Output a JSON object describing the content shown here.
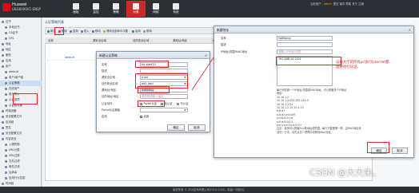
{
  "header": {
    "brand": "Huawei",
    "model": "USG6000V1-ENSP",
    "nav": [
      {
        "label": "面板",
        "icon": "dashboard-icon"
      },
      {
        "label": "监控",
        "icon": "monitor-icon"
      },
      {
        "label": "策略",
        "icon": "policy-icon"
      },
      {
        "label": "对象",
        "icon": "object-icon"
      },
      {
        "label": "网络",
        "icon": "network-icon"
      },
      {
        "label": "系统",
        "icon": "system-icon"
      }
    ],
    "userinfo_prefix": "当前用户：",
    "username": "admin",
    "userinfo_rest": " 提交  保存  帮助  关于  注销"
  },
  "sidebar": {
    "items": [
      {
        "label": "证书"
      },
      {
        "label": "本地证书"
      },
      {
        "label": "CA证书"
      },
      {
        "label": "CRL"
      },
      {
        "label": "地址"
      },
      {
        "label": "地区"
      },
      {
        "label": "服务"
      },
      {
        "label": "应用"
      },
      {
        "label": "用户"
      },
      {
        "label": "default"
      },
      {
        "label": "用户/用户组"
      },
      {
        "label": "认证策略"
      },
      {
        "label": "在线用户"
      },
      {
        "label": "用户导入"
      },
      {
        "label": "认证选项"
      },
      {
        "label": "认证服务器"
      },
      {
        "label": "终端设备"
      },
      {
        "label": "安全配置文件"
      },
      {
        "label": "应用组"
      },
      {
        "label": "签名"
      },
      {
        "label": "安全配置文件"
      },
      {
        "label": "内容安全"
      },
      {
        "label": "入侵防御"
      },
      {
        "label": "URL分类"
      },
      {
        "label": "URL过滤"
      },
      {
        "label": "文件过滤"
      },
      {
        "label": "邮件过滤"
      },
      {
        "label": "反病毒"
      },
      {
        "label": "应用行为控制"
      },
      {
        "label": "时间段"
      }
    ]
  },
  "main": {
    "tab": "认证策略列表",
    "toolbar": [
      "新建",
      "删除",
      "复制",
      "插入",
      "移动",
      "清除全部命中次数",
      "启用",
      "禁用"
    ],
    "search_label": "请输入要查询的内容",
    "columns": [
      "名称",
      "源安全区域",
      "目的安全区域",
      "源地址/地区",
      "目的地址/地区",
      "认证动作",
      "命中次数",
      "启用",
      "编辑"
    ],
    "rows": [
      {
        "name": "default"
      }
    ]
  },
  "dialog1": {
    "title": "新建认证策略",
    "fields": [
      {
        "label": "名称",
        "value": "for-alert10"
      },
      {
        "label": "描述",
        "value": ""
      },
      {
        "label": "源安全区域",
        "value": "trust"
      },
      {
        "label": "目的安全区域",
        "value": "ad1_bad"
      },
      {
        "label": "源地址/地区",
        "value": "fsdfdsing"
      },
      {
        "label": "目的地址/地区",
        "value": "请选择或输入地址"
      }
    ],
    "auth_action_label": "认证动作",
    "auth_options": [
      "Portal认证",
      "免认证",
      "不认证"
    ],
    "portal_label": "Portal认证模板",
    "enable_label": "启用",
    "ok": "确定",
    "cancel": "取消"
  },
  "dialog2": {
    "title": "新建地址",
    "name_label": "名称",
    "name_value": "fsdfdsing",
    "desc_label": "描述",
    "ip_label": "IP地址/范围/MAC地址",
    "ip_placeholder": "请输入IP地址/范围",
    "ip_value": "192.168.10.0/24",
    "annotation": "设备大厅的所有pc访问internet都需要进行认证。",
    "help_lines": [
      "每行可配置一个IP地址/范围或MAC地址，可以配置多个IP地址",
      "例如：",
      "10.10.1.2",
      "10.10.1.2/255.255.255.0",
      "10.10.1.2/24",
      "10.10.1.2-10.10.1.10",
      "a:b:d:f",
      "a:b:d:f-a:b:d:ff",
      "a:0:b:0:0:c:d",
      "a:0:d:0:0:0:1",
      "a:b:c:d:e:f:0:0:0:0:f",
      "注意：最多可以配置512条地址或范围，每行只能配置一条，且MAC地址也",
      "请在一行中，请先点击一项再手动修改MAC地址。"
    ],
    "ok": "确定",
    "cancel": "取消"
  },
  "footer": "版权所有 © 华为技术有限公司2014-2018，保留一切权利。",
  "watermark": "CSDN @大大朱、"
}
